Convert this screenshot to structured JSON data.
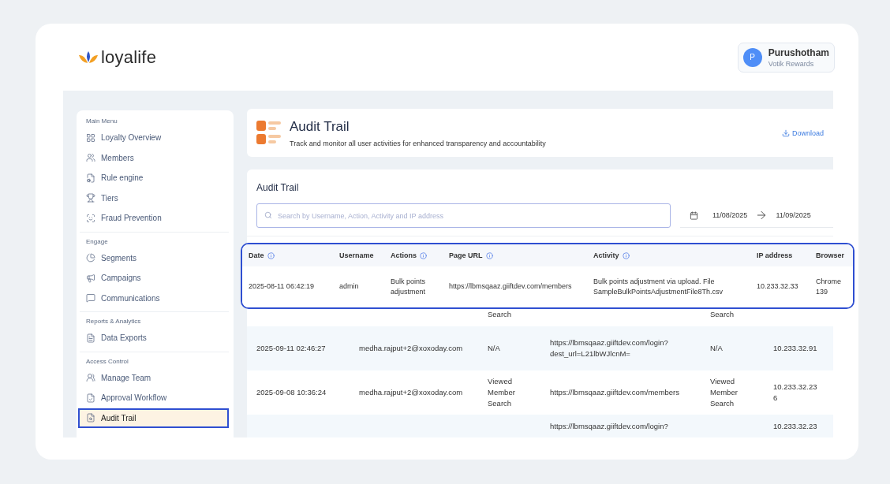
{
  "brand": {
    "name": "loyalife"
  },
  "user": {
    "initial": "P",
    "name": "Purushotham",
    "org": "Votik Rewards"
  },
  "sidebar": {
    "sections": [
      {
        "title": "Main Menu",
        "items": [
          {
            "label": "Loyalty Overview",
            "selected": false
          },
          {
            "label": "Members",
            "selected": false
          },
          {
            "label": "Rule engine",
            "selected": false
          },
          {
            "label": "Tiers",
            "selected": false
          },
          {
            "label": "Fraud Prevention",
            "selected": false
          }
        ]
      },
      {
        "title": "Engage",
        "items": [
          {
            "label": "Segments",
            "selected": false
          },
          {
            "label": "Campaigns",
            "selected": false
          },
          {
            "label": "Communications",
            "selected": false
          }
        ]
      },
      {
        "title": "Reports & Analytics",
        "items": [
          {
            "label": "Data Exports",
            "selected": false
          }
        ]
      },
      {
        "title": "Access Control",
        "items": [
          {
            "label": "Manage Team",
            "selected": false
          },
          {
            "label": "Approval Workflow",
            "selected": false
          },
          {
            "label": "Audit Trail",
            "selected": true
          }
        ]
      }
    ]
  },
  "page_header": {
    "title": "Audit Trail",
    "subtitle": "Track and monitor all user activities for enhanced transparency and accountability",
    "download": "Download"
  },
  "audit": {
    "title": "Audit Trail",
    "search": {
      "placeholder": "Search by Username, Action, Activity and IP address"
    },
    "date_from": "11/08/2025",
    "date_to": "11/09/2025"
  },
  "table": {
    "rows": [
      {
        "actions": "Search",
        "activity": "Search"
      },
      {
        "date": "2025-09-11 02:46:27",
        "username": "medha.rajput+2@xoxoday.com",
        "actions": "N/A",
        "page_url": "https://lbmsqaaz.giiftdev.com/login?\ndest_url=L21lbWJlcnM=",
        "activity": "N/A",
        "ip": "10.233.32.91"
      },
      {
        "date": "2025-09-08 10:36:24",
        "username": "medha.rajput+2@xoxoday.com",
        "actions": "Viewed\nMember\nSearch",
        "page_url": "https://lbmsqaaz.giiftdev.com/members",
        "activity": "Viewed\nMember\nSearch",
        "ip": "10.233.32.23\n6"
      },
      {
        "page_url": "https://lbmsqaaz.giiftdev.com/login?",
        "ip": "10.233.32.23"
      }
    ]
  },
  "highlight": {
    "columns": [
      {
        "label": "Date",
        "info": true
      },
      {
        "label": "Username",
        "info": false
      },
      {
        "label": "Actions",
        "info": true
      },
      {
        "label": "Page URL",
        "info": true
      },
      {
        "label": "Activity",
        "info": true
      },
      {
        "label": "IP address",
        "info": false
      },
      {
        "label": "Browser",
        "info": false
      }
    ],
    "row": [
      "2025-08-11 06:42:19",
      "admin",
      "Bulk points\nadjustment",
      "https://lbmsqaaz.giiftdev.com/members",
      "Bulk points adjustment via upload. File\nSampleBulkPointsAdjustmentFile8Th.csv",
      "10.233.32.33",
      "Chrome\n139"
    ]
  }
}
